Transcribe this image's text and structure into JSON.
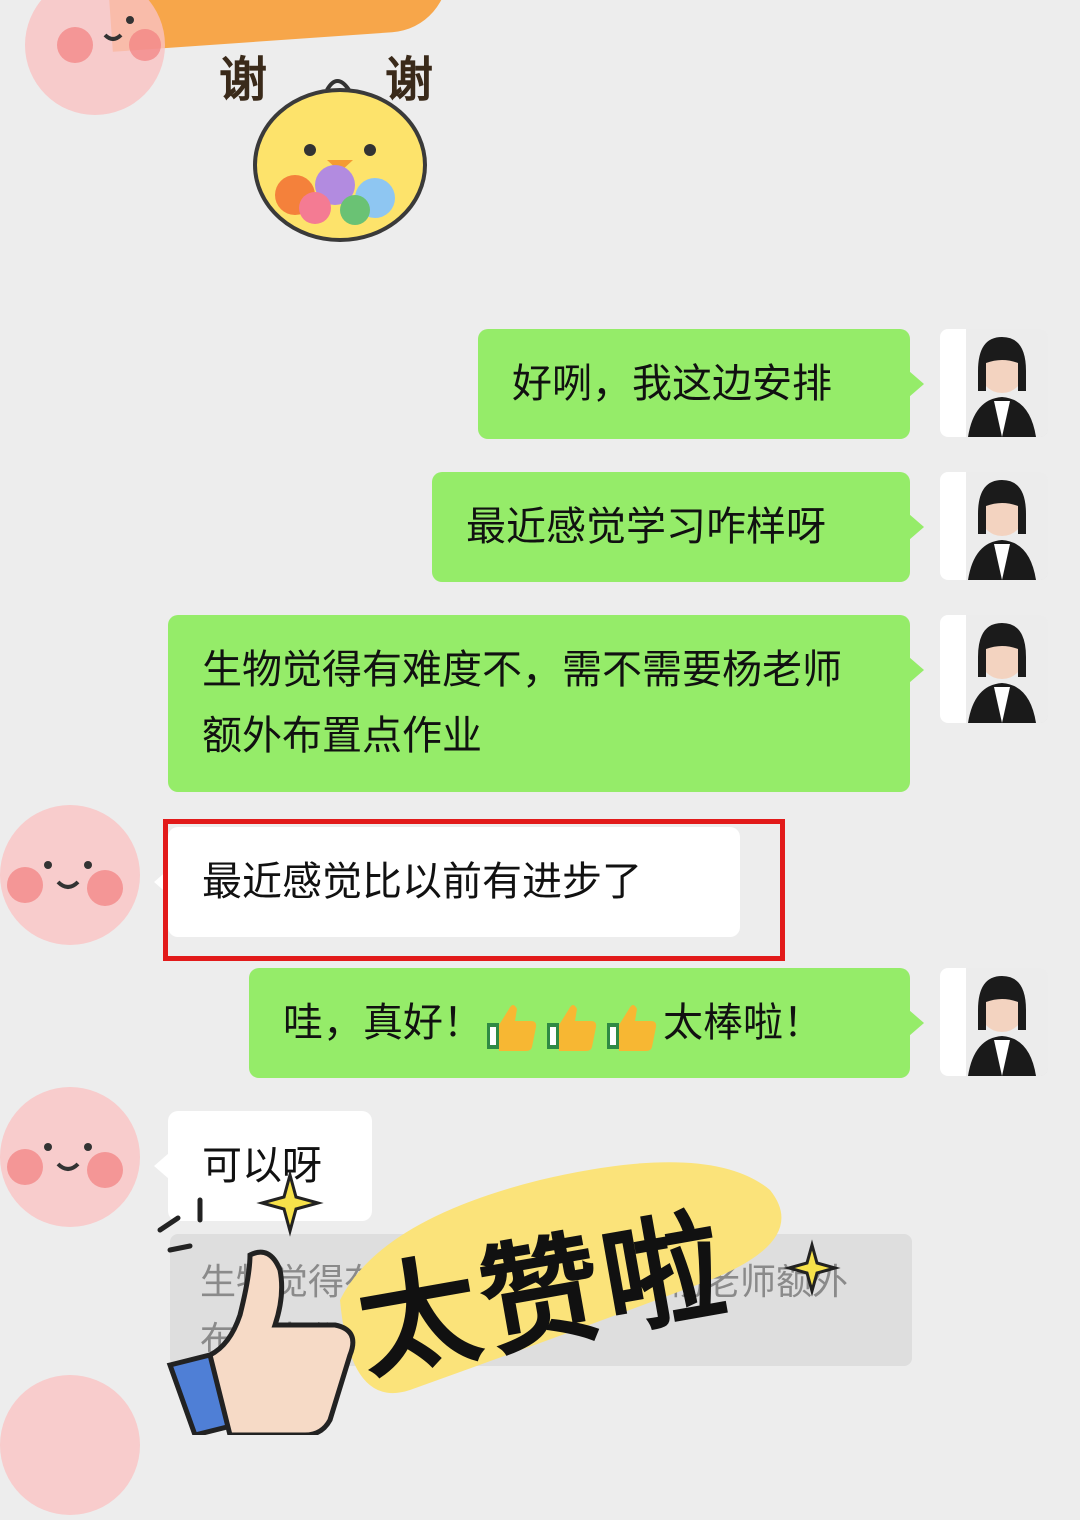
{
  "sticker_top": {
    "left_char": "谢",
    "right_char": "谢"
  },
  "messages": [
    {
      "side": "right",
      "text": "好咧，我这边安排"
    },
    {
      "side": "right",
      "text": "最近感觉学习咋样呀"
    },
    {
      "side": "right",
      "text": "生物觉得有难度不，需不需要杨老师额外布置点作业"
    },
    {
      "side": "left",
      "text": "最近感觉比以前有进步了",
      "highlighted": true
    },
    {
      "side": "right",
      "text_before": "哇，真好！",
      "emoji": "thumbs-up",
      "emoji_count": 3,
      "text_after": "太棒啦！"
    },
    {
      "side": "left",
      "text": "可以呀"
    }
  ],
  "quote": {
    "text": "生物觉得有难度不，需不需要杨老师额外布置点作业"
  },
  "sticker_bottom": {
    "text": "太赞啦"
  },
  "colors": {
    "background": "#ededed",
    "bubble_green": "#95ec69",
    "bubble_white": "#ffffff",
    "highlight": "#e21a1a",
    "sticker_yellow": "#fbe37a"
  }
}
